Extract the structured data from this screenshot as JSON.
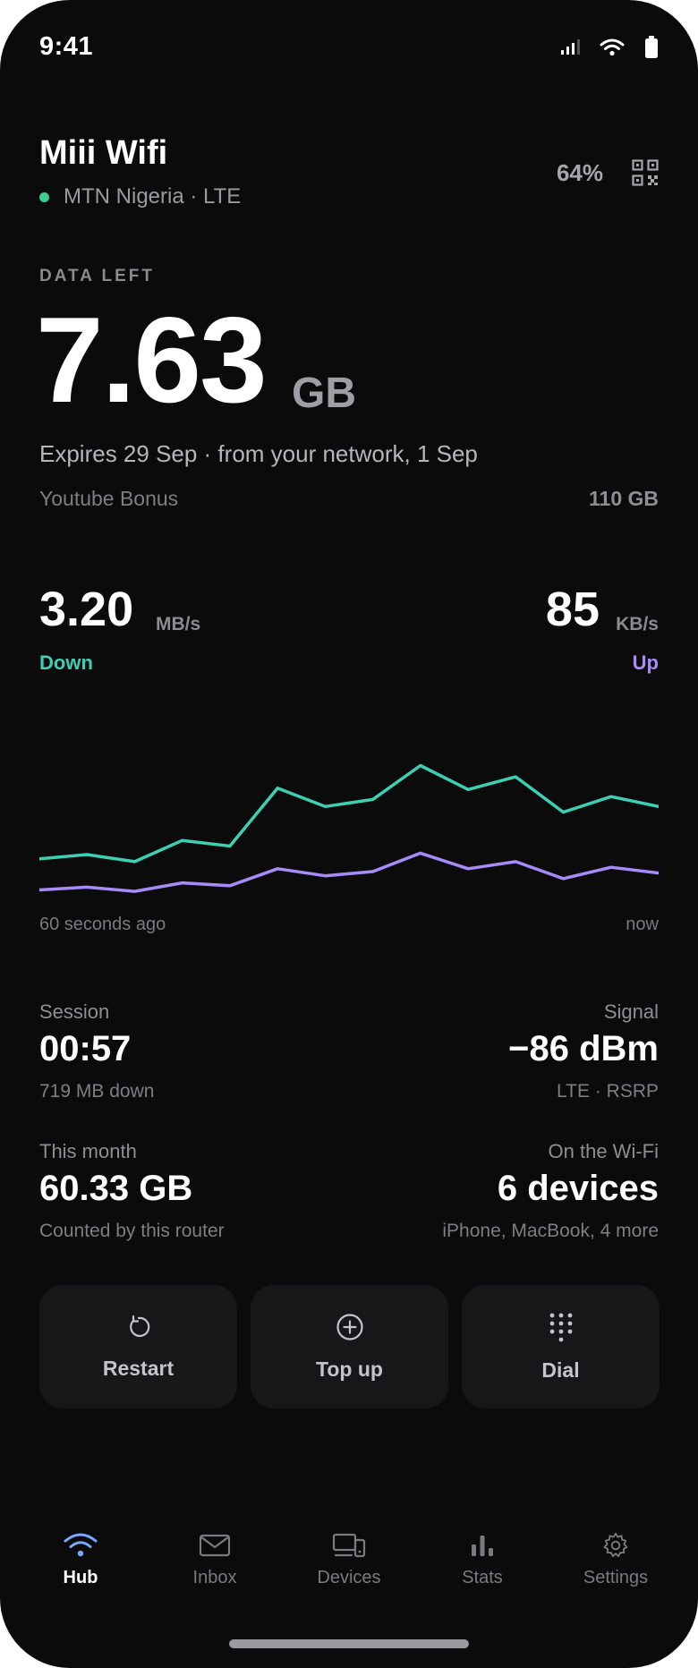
{
  "status_bar": {
    "time": "9:41"
  },
  "header": {
    "title": "Miii Wifi",
    "carrier": "MTN Nigeria · LTE",
    "battery": "64%"
  },
  "data_left": {
    "label": "DATA LEFT",
    "value": "7.63",
    "unit": "GB",
    "expires": "Expires 29 Sep · from your network, 1 Sep",
    "bonus_label": "Youtube Bonus",
    "bonus_value": "110 GB"
  },
  "speed": {
    "down_value": "3.20",
    "down_unit": "MB/s",
    "down_label": "Down",
    "up_value": "85",
    "up_unit": "KB/s",
    "up_label": "Up"
  },
  "chart_data": {
    "type": "line",
    "x_start_label": "60 seconds ago",
    "x_end_label": "now",
    "series": [
      {
        "name": "Down",
        "color": "#3ecfb2",
        "values": [
          1.4,
          1.55,
          1.3,
          2.05,
          1.85,
          3.9,
          3.25,
          3.5,
          4.7,
          3.85,
          4.3,
          3.05,
          3.6,
          3.25
        ]
      },
      {
        "name": "Up",
        "color": "#a78bfa",
        "values": [
          0.3,
          0.4,
          0.25,
          0.55,
          0.45,
          1.05,
          0.8,
          0.95,
          1.6,
          1.05,
          1.3,
          0.7,
          1.1,
          0.9
        ]
      }
    ]
  },
  "stats": {
    "session": {
      "label": "Session",
      "value": "00:57",
      "sub": "719 MB down"
    },
    "signal": {
      "label": "Signal",
      "value": "−86 dBm",
      "sub": "LTE · RSRP"
    },
    "month": {
      "label": "This month",
      "value": "60.33 GB",
      "sub": "Counted by this router"
    },
    "wifi": {
      "label": "On the Wi-Fi",
      "value": "6 devices",
      "sub": "iPhone, MacBook, 4 more"
    }
  },
  "actions": {
    "restart": "Restart",
    "topup": "Top up",
    "dial": "Dial"
  },
  "tabs": {
    "hub": "Hub",
    "inbox": "Inbox",
    "devices": "Devices",
    "stats": "Stats",
    "settings": "Settings"
  },
  "colors": {
    "background": "#0b0b0c",
    "accent_down": "#3ecfb2",
    "accent_up": "#a78bfa",
    "online_dot": "#3ecf8e",
    "active_tab_icon": "#7aa7ff"
  }
}
